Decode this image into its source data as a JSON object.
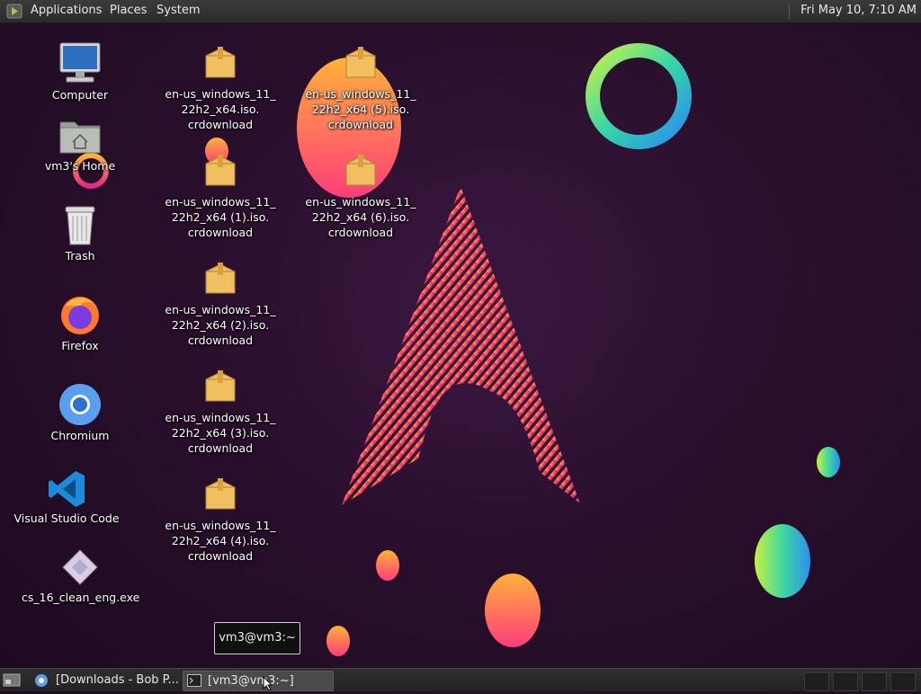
{
  "top_panel": {
    "menus": [
      "Applications",
      "Places",
      "System"
    ],
    "clock": "Fri May 10,  7:10 AM"
  },
  "desktop": {
    "icons": [
      {
        "label": "Computer",
        "icon": "computer-icon"
      },
      {
        "label": "vm3's Home",
        "icon": "home-folder-icon"
      },
      {
        "label": "Trash",
        "icon": "trash-icon"
      },
      {
        "label": "Firefox",
        "icon": "firefox-icon"
      },
      {
        "label": "Chromium",
        "icon": "chromium-icon"
      },
      {
        "label": "Visual Studio Code",
        "icon": "vscode-icon"
      },
      {
        "label": "cs_16_clean_eng.exe",
        "icon": "exe-file-icon"
      }
    ],
    "files": [
      {
        "label": "en-us_windows_11_\n22h2_x64.iso.\ncrdownload",
        "icon": "package-icon"
      },
      {
        "label": "en-us_windows_11_\n22h2_x64 (1).iso.\ncrdownload",
        "icon": "package-icon"
      },
      {
        "label": "en-us_windows_11_\n22h2_x64 (2).iso.\ncrdownload",
        "icon": "package-icon"
      },
      {
        "label": "en-us_windows_11_\n22h2_x64 (3).iso.\ncrdownload",
        "icon": "package-icon"
      },
      {
        "label": "en-us_windows_11_\n22h2_x64 (4).iso.\ncrdownload",
        "icon": "package-icon"
      },
      {
        "label": "en-us_windows_11_\n22h2_x64 (5).iso.\ncrdownload",
        "icon": "package-icon"
      },
      {
        "label": "en-us_windows_11_\n22h2_x64 (6).iso.\ncrdownload",
        "icon": "package-icon"
      }
    ]
  },
  "tooltip": "vm3@vm3:~",
  "taskbar": {
    "tasks": [
      {
        "label": "[Downloads - Bob P...",
        "icon": "browser-icon"
      },
      {
        "label": "[vm3@vm3:~]",
        "icon": "terminal-icon"
      }
    ]
  },
  "colors": {
    "panel": "#2b2b2b",
    "wallpaper": "#2a0f2c",
    "accent_pink": "#e8307a",
    "accent_orange": "#ffa030"
  }
}
